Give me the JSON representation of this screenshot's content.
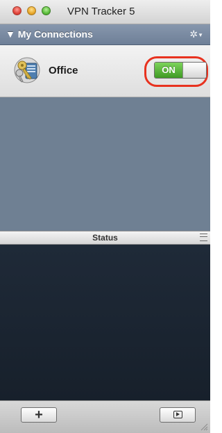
{
  "window": {
    "title": "VPN Tracker 5"
  },
  "connections": {
    "header": "▼ My Connections",
    "gear_icon": "gear-icon",
    "items": [
      {
        "name": "Office",
        "status_label": "ON",
        "icon": "vpn-keys-icon"
      }
    ]
  },
  "status": {
    "header": "Status"
  },
  "toolbar": {
    "add_label": "+",
    "connect_icon": "play-icon"
  },
  "colors": {
    "header_blue": "#7b8ba1",
    "empty_area": "#6f8093",
    "status_bg": "#1c2633",
    "toggle_on": "#5bbd3b",
    "highlight": "#e8321f"
  }
}
